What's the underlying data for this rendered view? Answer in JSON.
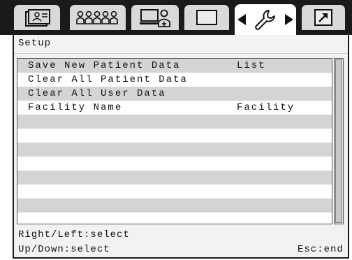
{
  "tabs": [
    {
      "icon": "patient-card-icon"
    },
    {
      "icon": "group-users-icon"
    },
    {
      "icon": "computer-user-icon"
    },
    {
      "icon": "blank-screen-icon"
    },
    {
      "icon": "wrench-icon",
      "active": true
    },
    {
      "icon": "export-arrow-icon"
    }
  ],
  "panel": {
    "title": "Setup"
  },
  "menu": [
    {
      "label": "Save New Patient Data",
      "value": "List"
    },
    {
      "label": "Clear All Patient Data",
      "value": ""
    },
    {
      "label": "Clear All User Data",
      "value": ""
    },
    {
      "label": "Facility Name",
      "value": "Facility"
    }
  ],
  "footer": {
    "hint_lr": "Right/Left:select",
    "hint_ud": "Up/Down:select",
    "esc": "Esc:end"
  },
  "colors": {
    "row_grey": "#d4d4d4",
    "tabbar": "#1a1a1a"
  }
}
